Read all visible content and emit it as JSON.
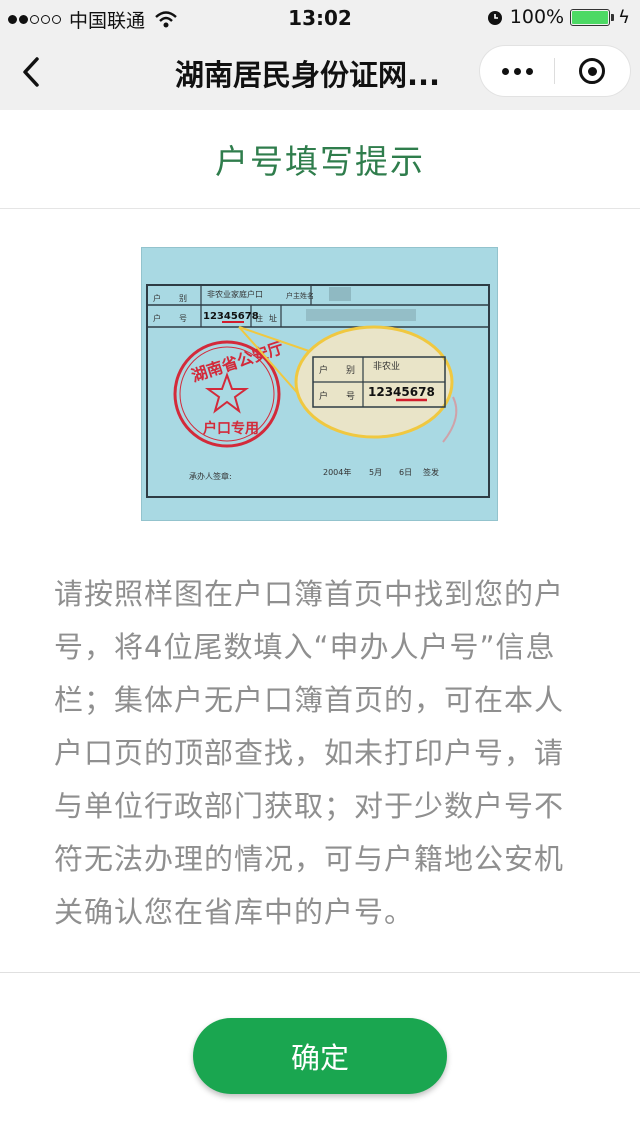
{
  "status_bar": {
    "carrier": "中国联通",
    "time": "13:02",
    "battery": "100%",
    "battery_level": 1.0
  },
  "nav": {
    "title": "湖南居民身份证网..."
  },
  "page": {
    "title": "户号填写提示"
  },
  "sample_image": {
    "row1_label_1": "户",
    "row1_label_2": "别",
    "row1_value": "非农业家庭户口",
    "row1_label_3": "户主姓名",
    "row2_label_1": "户",
    "row2_label_2": "号",
    "row2_value": "12345678",
    "row2_label_3": "住",
    "row2_label_4": "址",
    "stamp_top": "湖南省公安厅",
    "stamp_bottom": "户口专用",
    "zoom_label_1": "户",
    "zoom_label_2": "别",
    "zoom_value_1": "非农业",
    "zoom_label_3": "户",
    "zoom_label_4": "号",
    "zoom_value_2": "12345678",
    "signer_label": "承办人签章:",
    "date_year": "2004年",
    "date_month": "5月",
    "date_day": "6日",
    "date_action": "签发"
  },
  "description": {
    "text": "请按照样图在户口簿首页中找到您的户号，将4位尾数填入“申办人户号”信息栏；集体户无户口簿首页的，可在本人户口页的顶部查找，如未打印户号，请与单位行政部门获取；对于少数户号不符无法办理的情况，可与户籍地公安机关确认您在省库中的户号。"
  },
  "actions": {
    "confirm_label": "确定"
  },
  "colors": {
    "accent_green": "#1aa650",
    "title_green": "#2f7d4c",
    "description_gray": "#8f8f8f",
    "battery_green": "#4cd964"
  }
}
